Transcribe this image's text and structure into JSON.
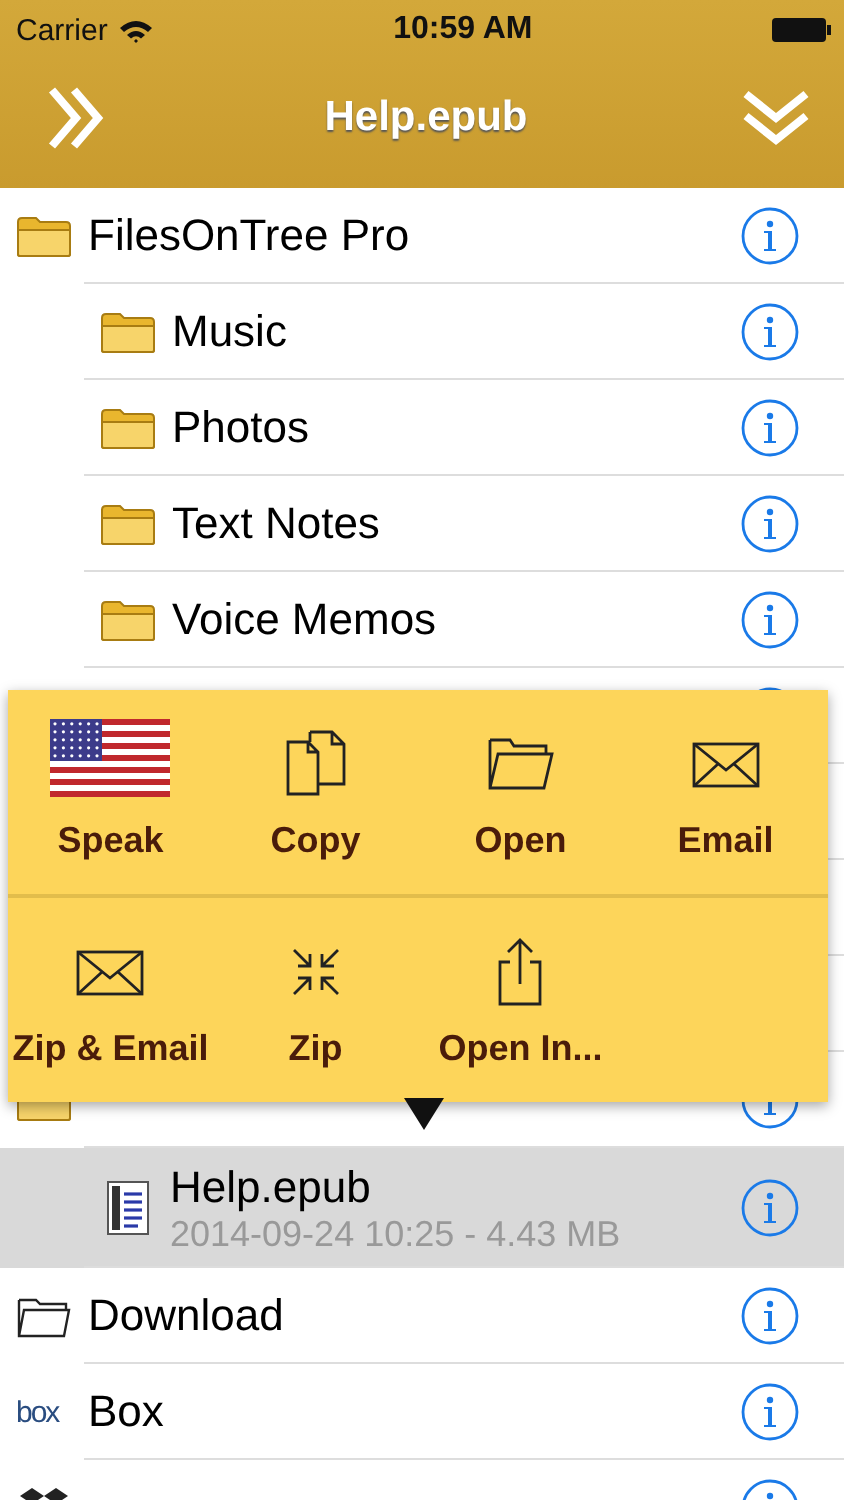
{
  "status_bar": {
    "carrier": "Carrier",
    "time": "10:59 AM"
  },
  "nav": {
    "title": "Help.epub"
  },
  "tree": [
    {
      "kind": "folder",
      "label": "FilesOnTree Pro",
      "selected": false,
      "children": [
        {
          "kind": "folder",
          "label": "Music",
          "selected": false
        },
        {
          "kind": "folder",
          "label": "Photos",
          "selected": false
        },
        {
          "kind": "folder",
          "label": "Text Notes",
          "selected": false
        },
        {
          "kind": "folder",
          "label": "Voice Memos",
          "selected": false
        },
        {
          "kind": "folder",
          "selected": false
        },
        {
          "kind": "covered"
        },
        {
          "kind": "covered"
        },
        {
          "kind": "covered"
        }
      ]
    },
    {
      "kind": "folder",
      "selected": false,
      "children": [
        {
          "kind": "document",
          "label": "Help.epub",
          "detail": "2014-09-24 10:25 - 4.43 MB",
          "selected": true
        }
      ]
    },
    {
      "kind": "folder-outline",
      "label": "Download",
      "selected": false
    },
    {
      "kind": "box",
      "logo_text": "box",
      "label": "Box",
      "selected": false
    },
    {
      "kind": "dropbox",
      "selected": false
    }
  ],
  "popup_menu": {
    "rows": [
      [
        {
          "kind": "flag",
          "label": "Speak"
        },
        {
          "kind": "copy",
          "label": "Copy"
        },
        {
          "kind": "open",
          "label": "Open"
        },
        {
          "kind": "email",
          "label": "Email"
        }
      ],
      [
        {
          "kind": "email",
          "label": "Zip & Email"
        },
        {
          "kind": "zip",
          "label": "Zip"
        },
        {
          "kind": "share",
          "label": "Open In..."
        }
      ]
    ]
  }
}
